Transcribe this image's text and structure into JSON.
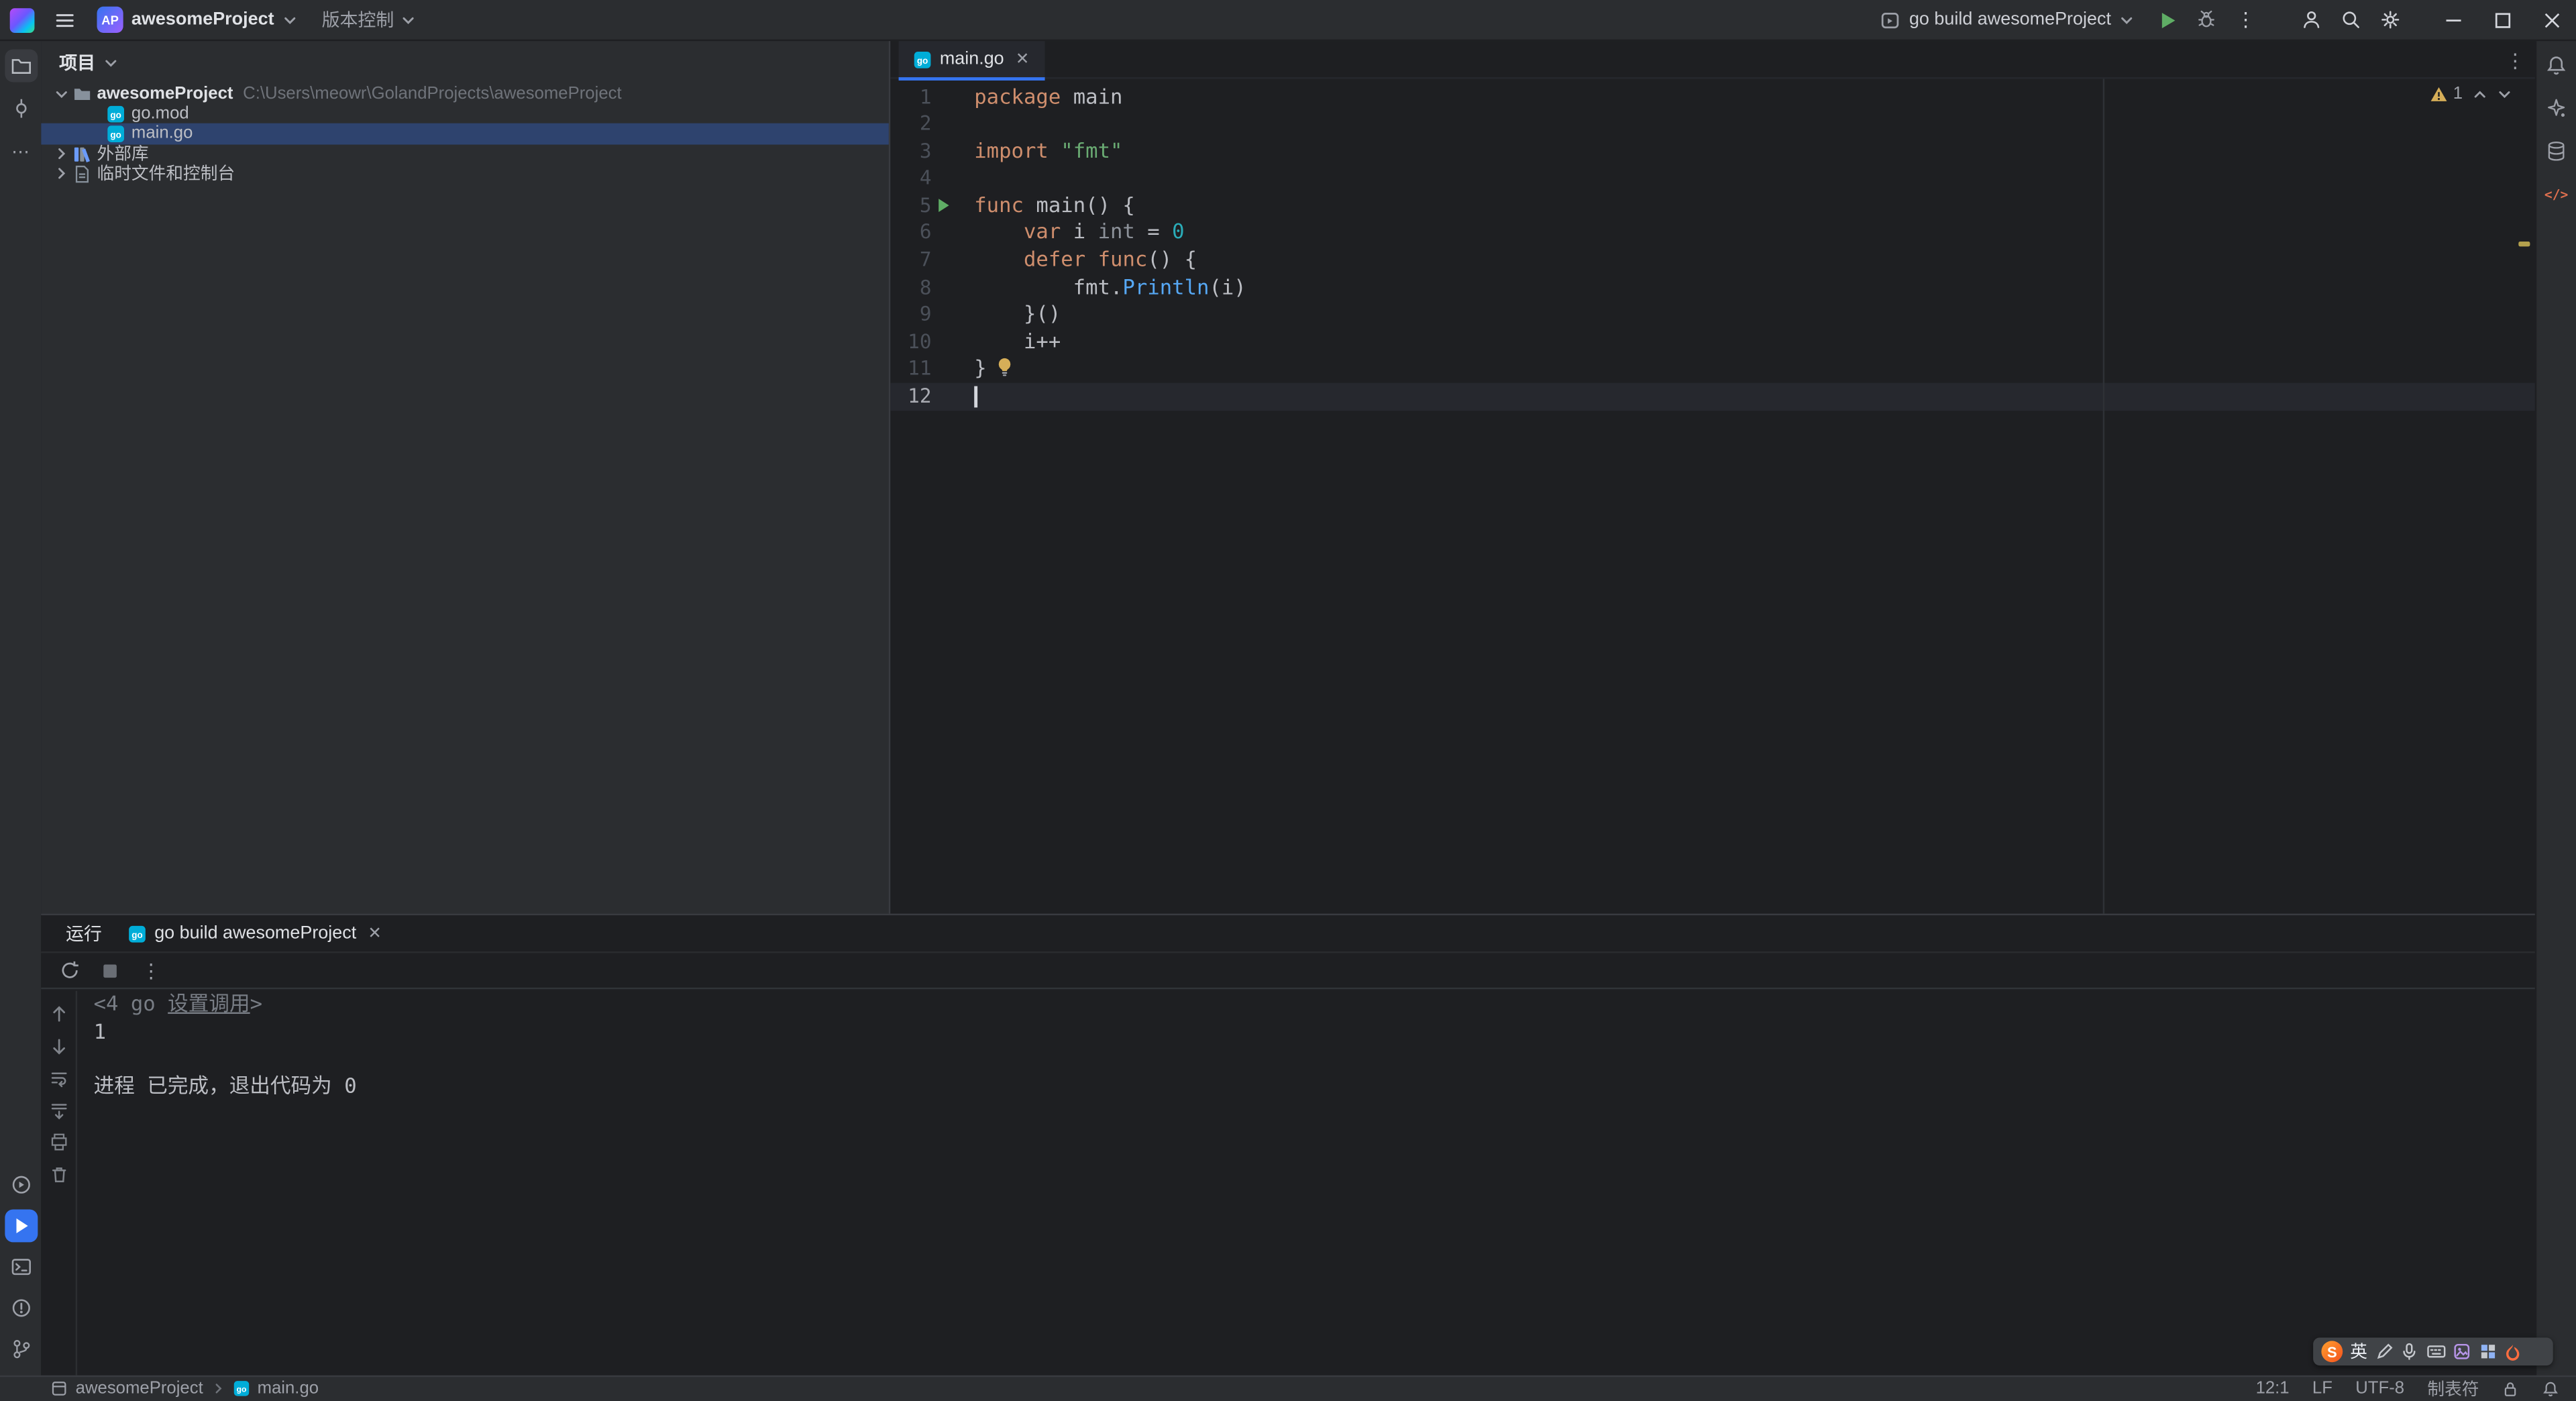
{
  "palette": {
    "keyword": "#cf8e6d",
    "string": "#6aab73",
    "number": "#2aacb8",
    "default": "#bcbec4",
    "muted": "#8c9199",
    "call": "#56a8f5",
    "gray": "#787d85",
    "accent": "#3574f0",
    "run_green": "#5fad65",
    "warning": "#d6ae58"
  },
  "titlebar": {
    "project_badge": "AP",
    "project_name": "awesomeProject",
    "vcs": "版本控制",
    "run_config": "go build awesomeProject"
  },
  "project_panel": {
    "title": "项目",
    "tree": [
      {
        "label": "awesomeProject",
        "path": "C:\\Users\\meowr\\GolandProjects\\awesomeProject",
        "icon": "folder",
        "chevron": "down",
        "bold": true
      },
      {
        "label": "go.mod",
        "icon": "go",
        "child": true
      },
      {
        "label": "main.go",
        "icon": "go",
        "child": true,
        "selected": true
      },
      {
        "label": "外部库",
        "icon": "library",
        "chevron": "right"
      },
      {
        "label": "临时文件和控制台",
        "icon": "scratch",
        "chevron": "right"
      }
    ]
  },
  "editor": {
    "tab": "main.go",
    "warnings": "1",
    "lines": [
      {
        "n": 1,
        "tokens": [
          [
            "package",
            "k"
          ],
          [
            " main",
            "d"
          ]
        ]
      },
      {
        "n": 2,
        "tokens": []
      },
      {
        "n": 3,
        "tokens": [
          [
            "import",
            "k"
          ],
          [
            " ",
            "d"
          ],
          [
            "\"fmt\"",
            "s"
          ]
        ]
      },
      {
        "n": 4,
        "tokens": []
      },
      {
        "n": 5,
        "run": true,
        "tokens": [
          [
            "func",
            "k"
          ],
          [
            " main() {",
            "d"
          ]
        ]
      },
      {
        "n": 6,
        "tokens": [
          [
            "    ",
            "d"
          ],
          [
            "var",
            "k"
          ],
          [
            " i ",
            "d"
          ],
          [
            "int",
            "m"
          ],
          [
            " = ",
            "d"
          ],
          [
            "0",
            "n"
          ]
        ]
      },
      {
        "n": 7,
        "tokens": [
          [
            "    ",
            "d"
          ],
          [
            "defer",
            "k"
          ],
          [
            " ",
            "d"
          ],
          [
            "func",
            "k"
          ],
          [
            "() {",
            "d"
          ]
        ]
      },
      {
        "n": 8,
        "tokens": [
          [
            "        fmt.",
            "d"
          ],
          [
            "Println",
            "f"
          ],
          [
            "(i)",
            "d"
          ]
        ]
      },
      {
        "n": 9,
        "tokens": [
          [
            "    }()",
            "d"
          ]
        ]
      },
      {
        "n": 10,
        "tokens": [
          [
            "    i++",
            "d"
          ]
        ]
      },
      {
        "n": 11,
        "bulb": true,
        "tokens": [
          [
            "}",
            "d"
          ]
        ]
      },
      {
        "n": 12,
        "caret": true,
        "tokens": []
      }
    ]
  },
  "run_panel": {
    "title": "运行",
    "tab": "go build awesomeProject",
    "console": [
      {
        "tokens": [
          [
            "<4 go ",
            "g"
          ],
          [
            "设置调用",
            "gu"
          ],
          [
            ">",
            "g"
          ]
        ]
      },
      {
        "tokens": [
          [
            "1",
            "d"
          ]
        ]
      },
      {
        "tokens": []
      },
      {
        "tokens": [
          [
            "进程 已完成，退出代码为 0",
            "d"
          ]
        ]
      }
    ]
  },
  "statusbar": {
    "breadcrumb": [
      "awesomeProject",
      "main.go"
    ],
    "caret_pos": "12:1",
    "line_sep": "LF",
    "encoding": "UTF-8",
    "indent": "制表符"
  },
  "ime": {
    "logo": "S",
    "lang": "英"
  }
}
